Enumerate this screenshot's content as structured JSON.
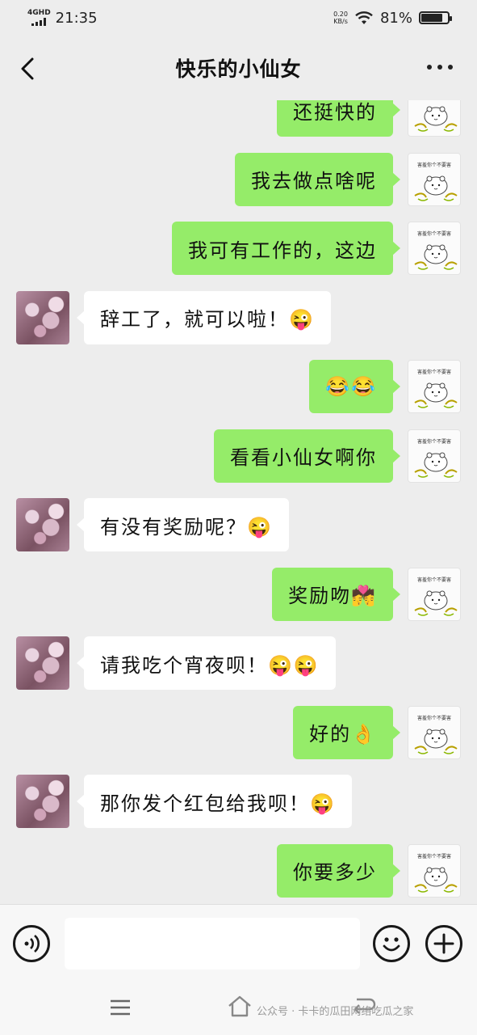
{
  "status_bar": {
    "network_type": "4G",
    "network_suffix": "HD",
    "time": "21:35",
    "net_speed_value": "0.20",
    "net_speed_unit": "KB/s",
    "battery": "81%",
    "battery_level": 0.81
  },
  "header": {
    "title": "快乐的小仙女",
    "back_icon": "chevron-left-icon",
    "more_icon": "more-dots-icon"
  },
  "messages": [
    {
      "from": "me",
      "text": "还挺快的"
    },
    {
      "from": "me",
      "text": "我去做点啥呢"
    },
    {
      "from": "me",
      "text": "我可有工作的，这边"
    },
    {
      "from": "them",
      "text": "辞工了，就可以啦！😜"
    },
    {
      "from": "me",
      "text": "😂😂"
    },
    {
      "from": "me",
      "text": "看看小仙女啊你"
    },
    {
      "from": "them",
      "text": "有没有奖励呢？😜"
    },
    {
      "from": "me",
      "text": "奖励吻💏"
    },
    {
      "from": "them",
      "text": "请我吃个宵夜呗！😜😜"
    },
    {
      "from": "me",
      "text": "好的👌"
    },
    {
      "from": "them",
      "text": "那你发个红包给我呗！😜"
    },
    {
      "from": "me",
      "text": "你要多少"
    }
  ],
  "my_avatar_text": "害羞你个不要害",
  "input_bar": {
    "voice_icon": "voice-icon",
    "emoji_icon": "emoji-face-icon",
    "plus_icon": "plus-icon",
    "placeholder": ""
  },
  "nav_bar": {
    "menu_icon": "menu-icon",
    "home_icon": "home-icon",
    "back_icon": "back-arrow-icon",
    "watermark": "公众号 · 卡卡的瓜田网络吃瓜之家"
  }
}
